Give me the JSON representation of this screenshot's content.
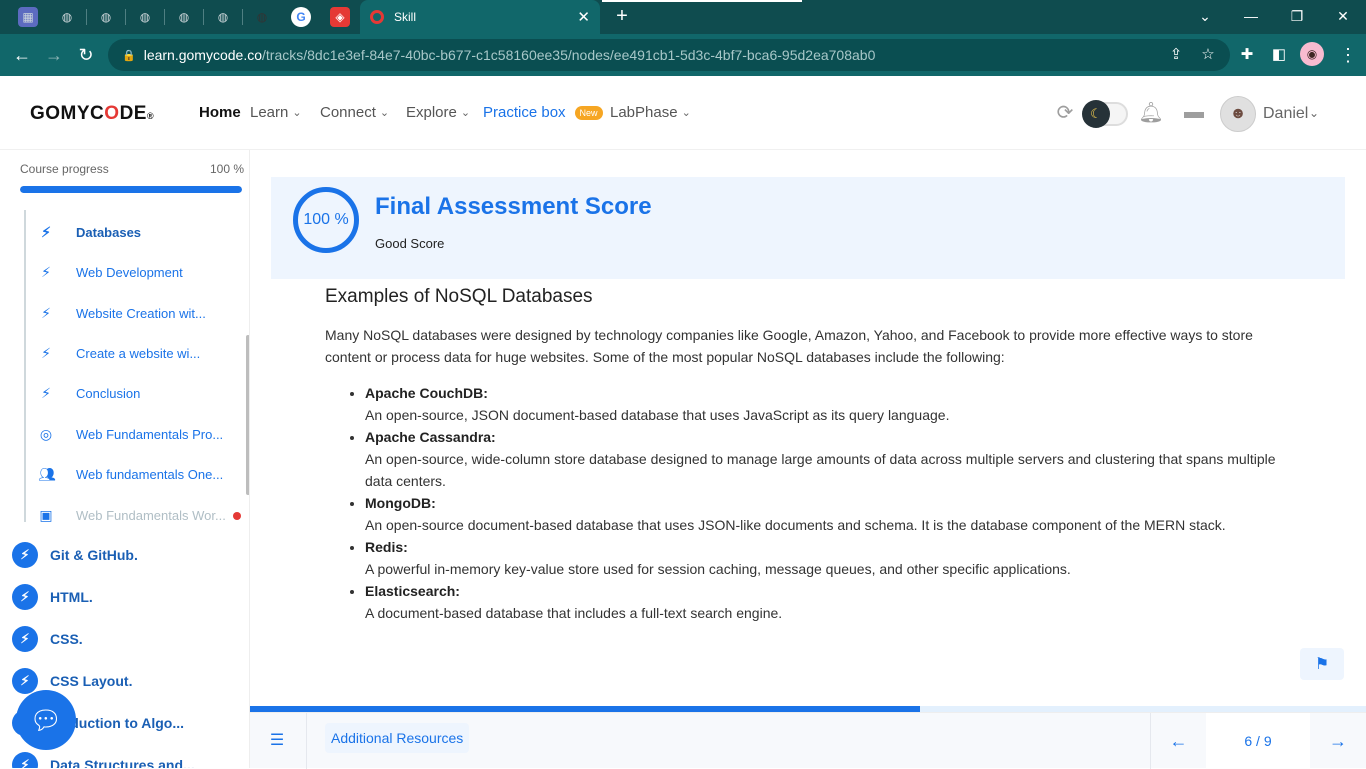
{
  "browser": {
    "active_tab_title": "Skill",
    "url_host": "learn.gomycode.co",
    "url_path": "/tracks/8dc1e3ef-84e7-40bc-b677-c1c58160ee35/nodes/ee491cb1-5d3c-4bf7-bca6-95d2ea708ab0"
  },
  "header": {
    "logo_pre": "GOMYC",
    "logo_o": "O",
    "logo_post": "DE",
    "logo_mark": "®",
    "nav": {
      "home": "Home",
      "learn": "Learn",
      "connect": "Connect",
      "explore": "Explore",
      "practice": "Practice box",
      "practice_badge": "New",
      "labphase": "LabPhase"
    },
    "user_name": "Daniel"
  },
  "sidebar": {
    "progress_label": "Course progress",
    "progress_value": "100 %",
    "progress_fraction": 1.0,
    "lessons": [
      {
        "label": "Databases",
        "icon": "bolt-icon",
        "state": "active"
      },
      {
        "label": "Web Development",
        "icon": "bolt-icon",
        "state": "normal"
      },
      {
        "label": "Website Creation wit...",
        "icon": "bolt-icon",
        "state": "normal"
      },
      {
        "label": "Create a website wi...",
        "icon": "bolt-icon",
        "state": "normal"
      },
      {
        "label": "Conclusion",
        "icon": "bolt-icon",
        "state": "normal"
      },
      {
        "label": "Web Fundamentals Pro...",
        "icon": "target-icon",
        "state": "normal"
      },
      {
        "label": "Web fundamentals One...",
        "icon": "people-icon",
        "state": "normal"
      },
      {
        "label": "Web Fundamentals Wor...",
        "icon": "workshop-icon",
        "state": "muted"
      }
    ],
    "modules": [
      {
        "label": "Git & GitHub."
      },
      {
        "label": "HTML."
      },
      {
        "label": "CSS."
      },
      {
        "label": "CSS Layout."
      },
      {
        "label": "...oduction to Algo..."
      },
      {
        "label": "Data Structures and..."
      }
    ]
  },
  "score": {
    "value": "100 %",
    "title": "Final Assessment Score",
    "subtitle": "Good Score"
  },
  "content": {
    "heading": "Examples of NoSQL Databases",
    "intro": "Many NoSQL databases were designed by technology companies like Google, Amazon, Yahoo, and Facebook to provide more effective ways to store content or process data for huge websites. Some of the most popular NoSQL databases include the following:",
    "items": [
      {
        "name": "Apache CouchDB:",
        "desc": "An open-source, JSON document-based database that uses JavaScript as its query language."
      },
      {
        "name": "Apache Cassandra:",
        "desc": "An open-source, wide-column store database designed to manage large amounts of data across multiple servers and clustering that spans multiple data centers."
      },
      {
        "name": "MongoDB:",
        "desc": "An open-source document-based database that uses JSON-like documents and schema. It is the database component of the MERN stack."
      },
      {
        "name": "Redis:",
        "desc": "A powerful in-memory key-value store used for session caching, message queues, and other specific applications."
      },
      {
        "name": "Elasticsearch:",
        "desc": "A document-based database that includes a full-text search engine."
      }
    ]
  },
  "footer": {
    "resources_label": "Additional Resources",
    "page_indicator": "6 / 9",
    "progress_fraction": 0.6
  },
  "colors": {
    "accent": "#1a73e8",
    "browser_frame": "#11676a",
    "notification_dot": "#e53935"
  }
}
